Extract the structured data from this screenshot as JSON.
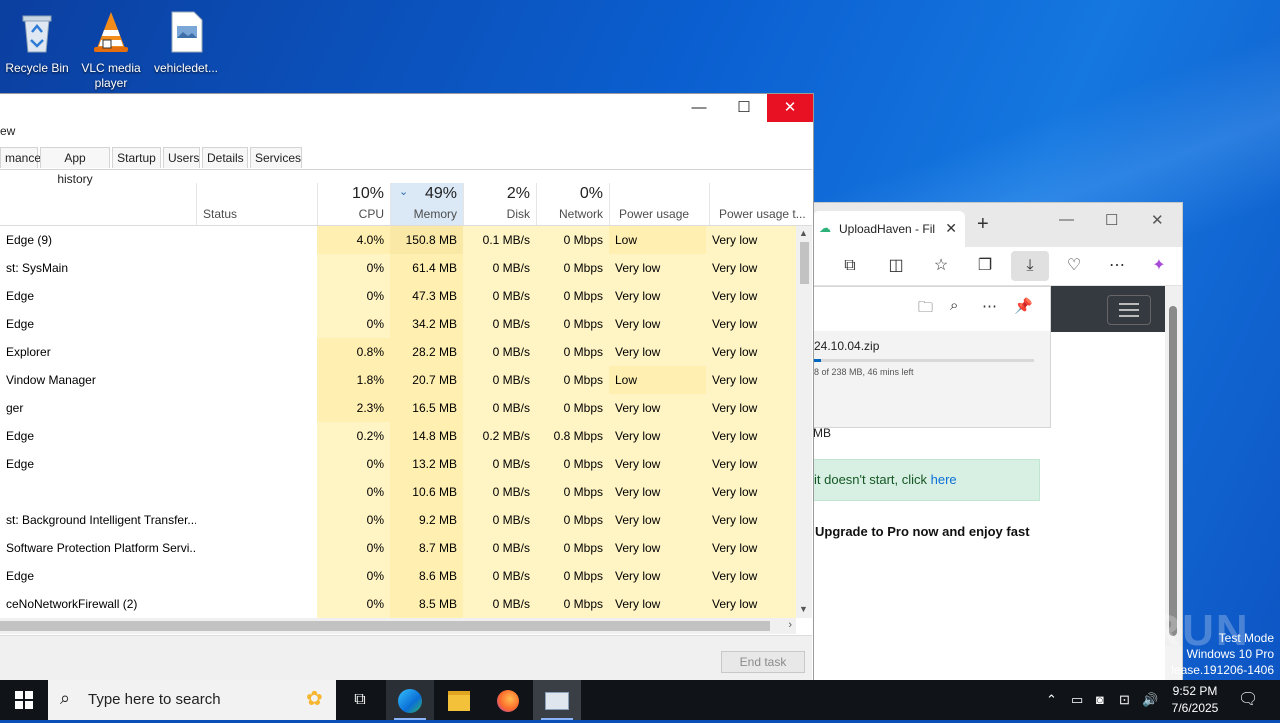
{
  "desktop": {
    "icons": [
      {
        "label": "Recycle Bin"
      },
      {
        "label": "VLC media player"
      },
      {
        "label": "vehicledet..."
      }
    ]
  },
  "edge": {
    "tab_title": "UploadHaven - Fil",
    "new_tab": "+",
    "download": {
      "filename": "24.10.04.zip",
      "status": "8 of 238 MB, 46 mins left",
      "progress": 0.03
    },
    "page": {
      "size_fragment": "MB",
      "notice_text": "it doesn't start, click ",
      "notice_link": "here",
      "promo": "Upgrade to Pro now and enjoy fast"
    }
  },
  "taskmgr": {
    "menu_fragment": "ew",
    "tabs": [
      "mance",
      "App history",
      "Startup",
      "Users",
      "Details",
      "Services"
    ],
    "columns": {
      "status": "Status",
      "cpu": {
        "pct": "10%",
        "label": "CPU"
      },
      "memory": {
        "pct": "49%",
        "label": "Memory"
      },
      "disk": {
        "pct": "2%",
        "label": "Disk"
      },
      "network": {
        "pct": "0%",
        "label": "Network"
      },
      "power": "Power usage",
      "power_trend": "Power usage t..."
    },
    "rows": [
      {
        "name": "Edge (9)",
        "cpu": "4.0%",
        "mem": "150.8 MB",
        "disk": "0.1 MB/s",
        "net": "0 Mbps",
        "power": "Low",
        "trend": "Very low"
      },
      {
        "name": "st: SysMain",
        "cpu": "0%",
        "mem": "61.4 MB",
        "disk": "0 MB/s",
        "net": "0 Mbps",
        "power": "Very low",
        "trend": "Very low"
      },
      {
        "name": "Edge",
        "cpu": "0%",
        "mem": "47.3 MB",
        "disk": "0 MB/s",
        "net": "0 Mbps",
        "power": "Very low",
        "trend": "Very low"
      },
      {
        "name": "Edge",
        "cpu": "0%",
        "mem": "34.2 MB",
        "disk": "0 MB/s",
        "net": "0 Mbps",
        "power": "Very low",
        "trend": "Very low"
      },
      {
        "name": "Explorer",
        "cpu": "0.8%",
        "mem": "28.2 MB",
        "disk": "0 MB/s",
        "net": "0 Mbps",
        "power": "Very low",
        "trend": "Very low"
      },
      {
        "name": "Vindow Manager",
        "cpu": "1.8%",
        "mem": "20.7 MB",
        "disk": "0 MB/s",
        "net": "0 Mbps",
        "power": "Low",
        "trend": "Very low"
      },
      {
        "name": "ger",
        "cpu": "2.3%",
        "mem": "16.5 MB",
        "disk": "0 MB/s",
        "net": "0 Mbps",
        "power": "Very low",
        "trend": "Very low"
      },
      {
        "name": "Edge",
        "cpu": "0.2%",
        "mem": "14.8 MB",
        "disk": "0.2 MB/s",
        "net": "0.8 Mbps",
        "power": "Very low",
        "trend": "Very low"
      },
      {
        "name": "Edge",
        "cpu": "0%",
        "mem": "13.2 MB",
        "disk": "0 MB/s",
        "net": "0 Mbps",
        "power": "Very low",
        "trend": "Very low"
      },
      {
        "name": "",
        "cpu": "0%",
        "mem": "10.6 MB",
        "disk": "0 MB/s",
        "net": "0 Mbps",
        "power": "Very low",
        "trend": "Very low"
      },
      {
        "name": "st: Background Intelligent Transfer...",
        "cpu": "0%",
        "mem": "9.2 MB",
        "disk": "0 MB/s",
        "net": "0 Mbps",
        "power": "Very low",
        "trend": "Very low"
      },
      {
        "name": "Software Protection Platform Servi...",
        "cpu": "0%",
        "mem": "8.7 MB",
        "disk": "0 MB/s",
        "net": "0 Mbps",
        "power": "Very low",
        "trend": "Very low"
      },
      {
        "name": "Edge",
        "cpu": "0%",
        "mem": "8.6 MB",
        "disk": "0 MB/s",
        "net": "0 Mbps",
        "power": "Very low",
        "trend": "Very low"
      },
      {
        "name": "ceNoNetworkFirewall (2)",
        "cpu": "0%",
        "mem": "8.5 MB",
        "disk": "0 MB/s",
        "net": "0 Mbps",
        "power": "Very low",
        "trend": "Very low"
      }
    ],
    "end_task": "End task"
  },
  "watermark": "ANY RUN",
  "testmode": {
    "line1": "Test Mode",
    "line2": "Windows 10 Pro",
    "line3": "lease.191206-1406"
  },
  "taskbar": {
    "search_placeholder": "Type here to search",
    "time": "9:52 PM",
    "date": "7/6/2025"
  },
  "colors": {
    "heat_light": "#fff4c4",
    "heat_mid": "#ffefb0",
    "heat_strong": "#f9e8a6",
    "accent": "#0067c0",
    "close_red": "#e81123"
  }
}
